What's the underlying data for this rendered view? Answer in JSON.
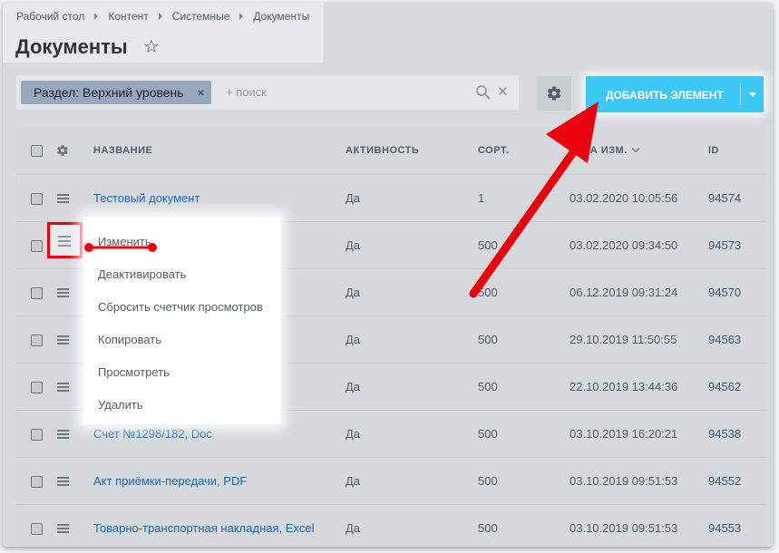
{
  "breadcrumbs": [
    "Рабочий стол",
    "Контент",
    "Системные",
    "Документы"
  ],
  "page_title": "Документы",
  "filter": {
    "chip_label": "Раздел: Верхний уровень",
    "placeholder": "+ поиск"
  },
  "toolbar": {
    "add_button_label": "ДОБАВИТЬ ЭЛЕМЕНТ"
  },
  "table": {
    "columns": [
      "НАЗВАНИЕ",
      "АКТИВНОСТЬ",
      "СОРТ.",
      "ДАТА ИЗМ.",
      "ID"
    ],
    "rows": [
      {
        "name": "Тестовый документ",
        "active": "Да",
        "sort": "1",
        "date": "03.02.2020 10:05:56",
        "id": "94574"
      },
      {
        "name": "",
        "active": "Да",
        "sort": "500",
        "date": "03.02.2020 09:34:50",
        "id": "94573"
      },
      {
        "name": "",
        "active": "Да",
        "sort": "500",
        "date": "06.12.2019 09:31:24",
        "id": "94570"
      },
      {
        "name": "",
        "active": "Да",
        "sort": "500",
        "date": "29.10.2019 11:50:55",
        "id": "94563"
      },
      {
        "name": "",
        "active": "Да",
        "sort": "500",
        "date": "22.10.2019 13:44:36",
        "id": "94562"
      },
      {
        "name": "Счет №1298/182, Doc",
        "active": "Да",
        "sort": "500",
        "date": "03.10.2019 16:20:21",
        "id": "94538"
      },
      {
        "name": "Акт приёмки-передачи, PDF",
        "active": "Да",
        "sort": "500",
        "date": "03.10.2019 09:51:53",
        "id": "94552"
      },
      {
        "name": "Товарно-транспортная накладная, Excel",
        "active": "Да",
        "sort": "500",
        "date": "03.10.2019 09:51:53",
        "id": "94553"
      }
    ]
  },
  "context_menu": {
    "items": [
      "Изменить",
      "Деактивировать",
      "Сбросить счетчик просмотров",
      "Копировать",
      "Просмотреть",
      "Удалить"
    ]
  },
  "colors": {
    "accent": "#3bc8f5",
    "annotation_red": "#e8000c",
    "link": "#2067b0"
  },
  "icons": [
    "star-icon",
    "search-icon",
    "close-icon",
    "gear-icon",
    "chevron-down-icon",
    "menu-icon",
    "arrow-annotation"
  ]
}
